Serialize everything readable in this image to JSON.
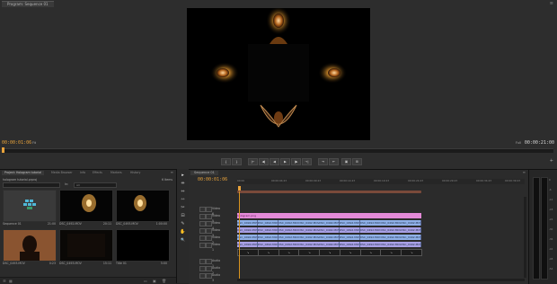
{
  "program_monitor": {
    "tab_label": "Program: Sequence 01",
    "timecode_current": "00:00:01:06",
    "timecode_duration": "00:00:21:00",
    "fit_label": "Fit",
    "resolution_label": "Full"
  },
  "transport_controls": [
    "{",
    "}",
    "|←",
    "◀|",
    "◀",
    "▶",
    "|▶",
    "→|",
    "⇥",
    "⇤",
    "▣",
    "⊞"
  ],
  "project_panel": {
    "tabs": [
      "Project: Hologram tutorial",
      "Media Browser",
      "Info",
      "Effects",
      "Markers",
      "History"
    ],
    "project_name": "hologram tutorial.prproj",
    "item_count": "6 Items",
    "in_label": "In:",
    "in_value": "All",
    "items": [
      {
        "name": "Sequence 01",
        "duration": "21:00",
        "kind": "sequence"
      },
      {
        "name": "DSC_0492.MOV",
        "duration": "20:11",
        "kind": "video"
      },
      {
        "name": "DSC_0493.MOV",
        "duration": "1:00:00",
        "kind": "video"
      },
      {
        "name": "DSC_0493.MOV",
        "duration": "0:23",
        "kind": "silhouette"
      },
      {
        "name": "DSC_0493.MOV",
        "duration": "15:11",
        "kind": "dark"
      },
      {
        "name": "Title 01",
        "duration": "5:00",
        "kind": "black"
      }
    ]
  },
  "tools": [
    "▸",
    "⇹",
    "⇔",
    "⇿",
    "✂",
    "⊟",
    "✎",
    "✋",
    "🔍"
  ],
  "timeline": {
    "tab_label": "Sequence 01",
    "timecode": "00:00:01:06",
    "ruler_labels": [
      "00:00",
      "00:00:04:23",
      "00:00:09:23",
      "00:00:14:23",
      "00:00:19:23",
      "00:00:24:23",
      "00:00:29:23",
      "00:00:34:23",
      "00:00:39:23"
    ],
    "tracks": [
      {
        "name": "Video 6",
        "type": "video"
      },
      {
        "name": "Video 5",
        "type": "video"
      },
      {
        "name": "Video 4",
        "type": "video"
      },
      {
        "name": "Video 3",
        "type": "video"
      },
      {
        "name": "Video 2",
        "type": "video"
      },
      {
        "name": "Video 1",
        "type": "video"
      },
      {
        "name": "Audio 1",
        "type": "audio"
      },
      {
        "name": "Audio 2",
        "type": "audio"
      },
      {
        "name": "Audio 3",
        "type": "audio"
      }
    ],
    "title_clip_label": "hologram.png",
    "clip_label": "DSC_0492.MOV",
    "clips_per_row": 9
  },
  "audio_meter_scale": [
    "0",
    "-6",
    "-12",
    "-18",
    "-24",
    "-30",
    "-36",
    "-42",
    "-48",
    "-54"
  ],
  "colors": {
    "accent": "#e8a23b",
    "title_clip": "#e48ad8",
    "video_clip": "#8fb0e8",
    "video_clip_alt": "#a9a0e6",
    "audio_clip": "#1c1c1c"
  }
}
